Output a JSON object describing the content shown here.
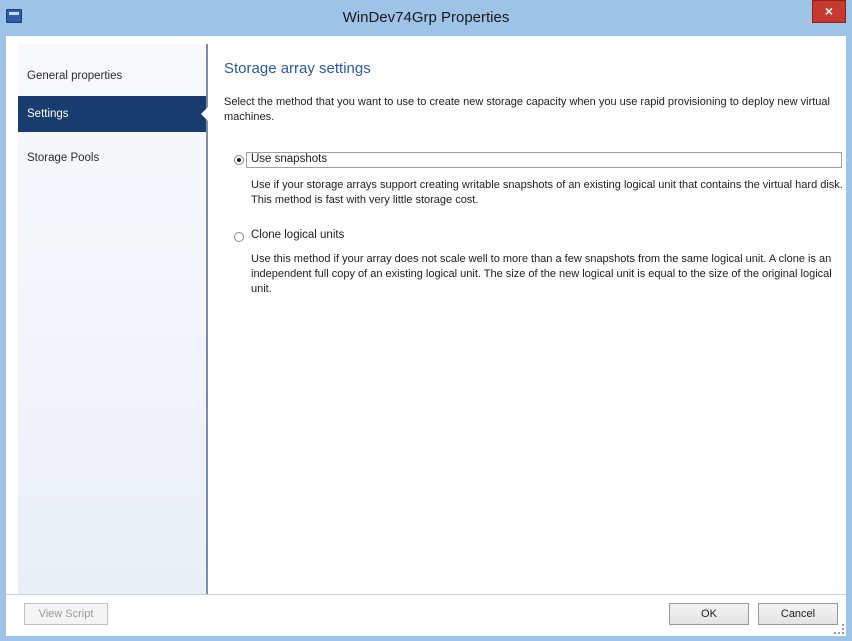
{
  "window": {
    "title": "WinDev74Grp Properties",
    "close_label": "×"
  },
  "sidebar": {
    "items": [
      {
        "label": "General properties",
        "selected": false
      },
      {
        "label": "Settings",
        "selected": true
      },
      {
        "label": "Storage Pools",
        "selected": false
      }
    ]
  },
  "main": {
    "heading": "Storage array settings",
    "intro": "Select the method that you want to use to create new storage capacity when you use rapid provisioning to deploy new virtual machines.",
    "options": [
      {
        "label": "Use snapshots",
        "checked": true,
        "description": "Use if your storage arrays support creating writable snapshots of an existing logical unit that contains the virtual hard disk. This method is fast with very little storage cost."
      },
      {
        "label": "Clone logical units",
        "checked": false,
        "description": "Use this method if your array does not scale well to more than a few snapshots from the same logical unit.  A clone is an independent full copy of an existing logical unit. The size of the new logical unit is equal to the size of the original logical unit."
      }
    ]
  },
  "footer": {
    "view_script_label": "View Script",
    "ok_label": "OK",
    "cancel_label": "Cancel"
  },
  "colors": {
    "titlebar": "#9ec3e8",
    "selected_nav": "#173c6e",
    "heading": "#2c5aa0",
    "close": "#c7392e"
  }
}
